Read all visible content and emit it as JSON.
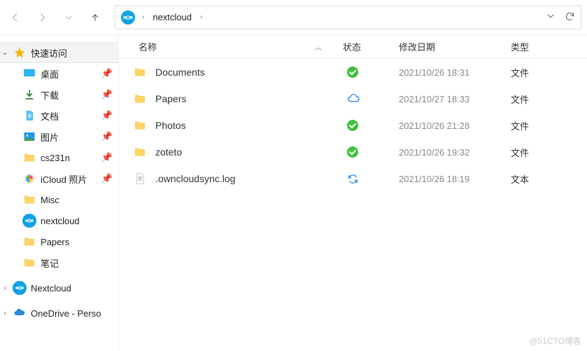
{
  "nav": {
    "crumb_label": "nextcloud"
  },
  "sidebar": {
    "quick_access": "快速访问",
    "items": [
      {
        "label": "桌面",
        "pinned": true,
        "icon": "desktop"
      },
      {
        "label": "下载",
        "pinned": true,
        "icon": "download"
      },
      {
        "label": "文档",
        "pinned": true,
        "icon": "document"
      },
      {
        "label": "图片",
        "pinned": true,
        "icon": "picture"
      },
      {
        "label": "cs231n",
        "pinned": true,
        "icon": "folder"
      },
      {
        "label": "iCloud 照片",
        "pinned": true,
        "icon": "icloud"
      },
      {
        "label": "Misc",
        "pinned": false,
        "icon": "folder"
      },
      {
        "label": "nextcloud",
        "pinned": false,
        "icon": "nextcloud"
      },
      {
        "label": "Papers",
        "pinned": false,
        "icon": "folder"
      },
      {
        "label": "笔记",
        "pinned": false,
        "icon": "folder"
      }
    ],
    "nextcloud_top": "Nextcloud",
    "onedrive": "OneDrive - Perso"
  },
  "columns": {
    "name": "名称",
    "status": "状态",
    "date": "修改日期",
    "type": "类型"
  },
  "files": [
    {
      "name": "Documents",
      "status": "ok",
      "date": "2021/10/26 18:31",
      "type": "文件",
      "icon": "folder"
    },
    {
      "name": "Papers",
      "status": "cloud",
      "date": "2021/10/27 18:33",
      "type": "文件",
      "icon": "folder"
    },
    {
      "name": "Photos",
      "status": "ok",
      "date": "2021/10/26 21:28",
      "type": "文件",
      "icon": "folder"
    },
    {
      "name": "zoteto",
      "status": "ok",
      "date": "2021/10/26 19:32",
      "type": "文件",
      "icon": "folder"
    },
    {
      "name": ".owncloudsync.log",
      "status": "sync",
      "date": "2021/10/26 18:19",
      "type": "文本",
      "icon": "text"
    }
  ],
  "watermark": "@51CTO博客"
}
